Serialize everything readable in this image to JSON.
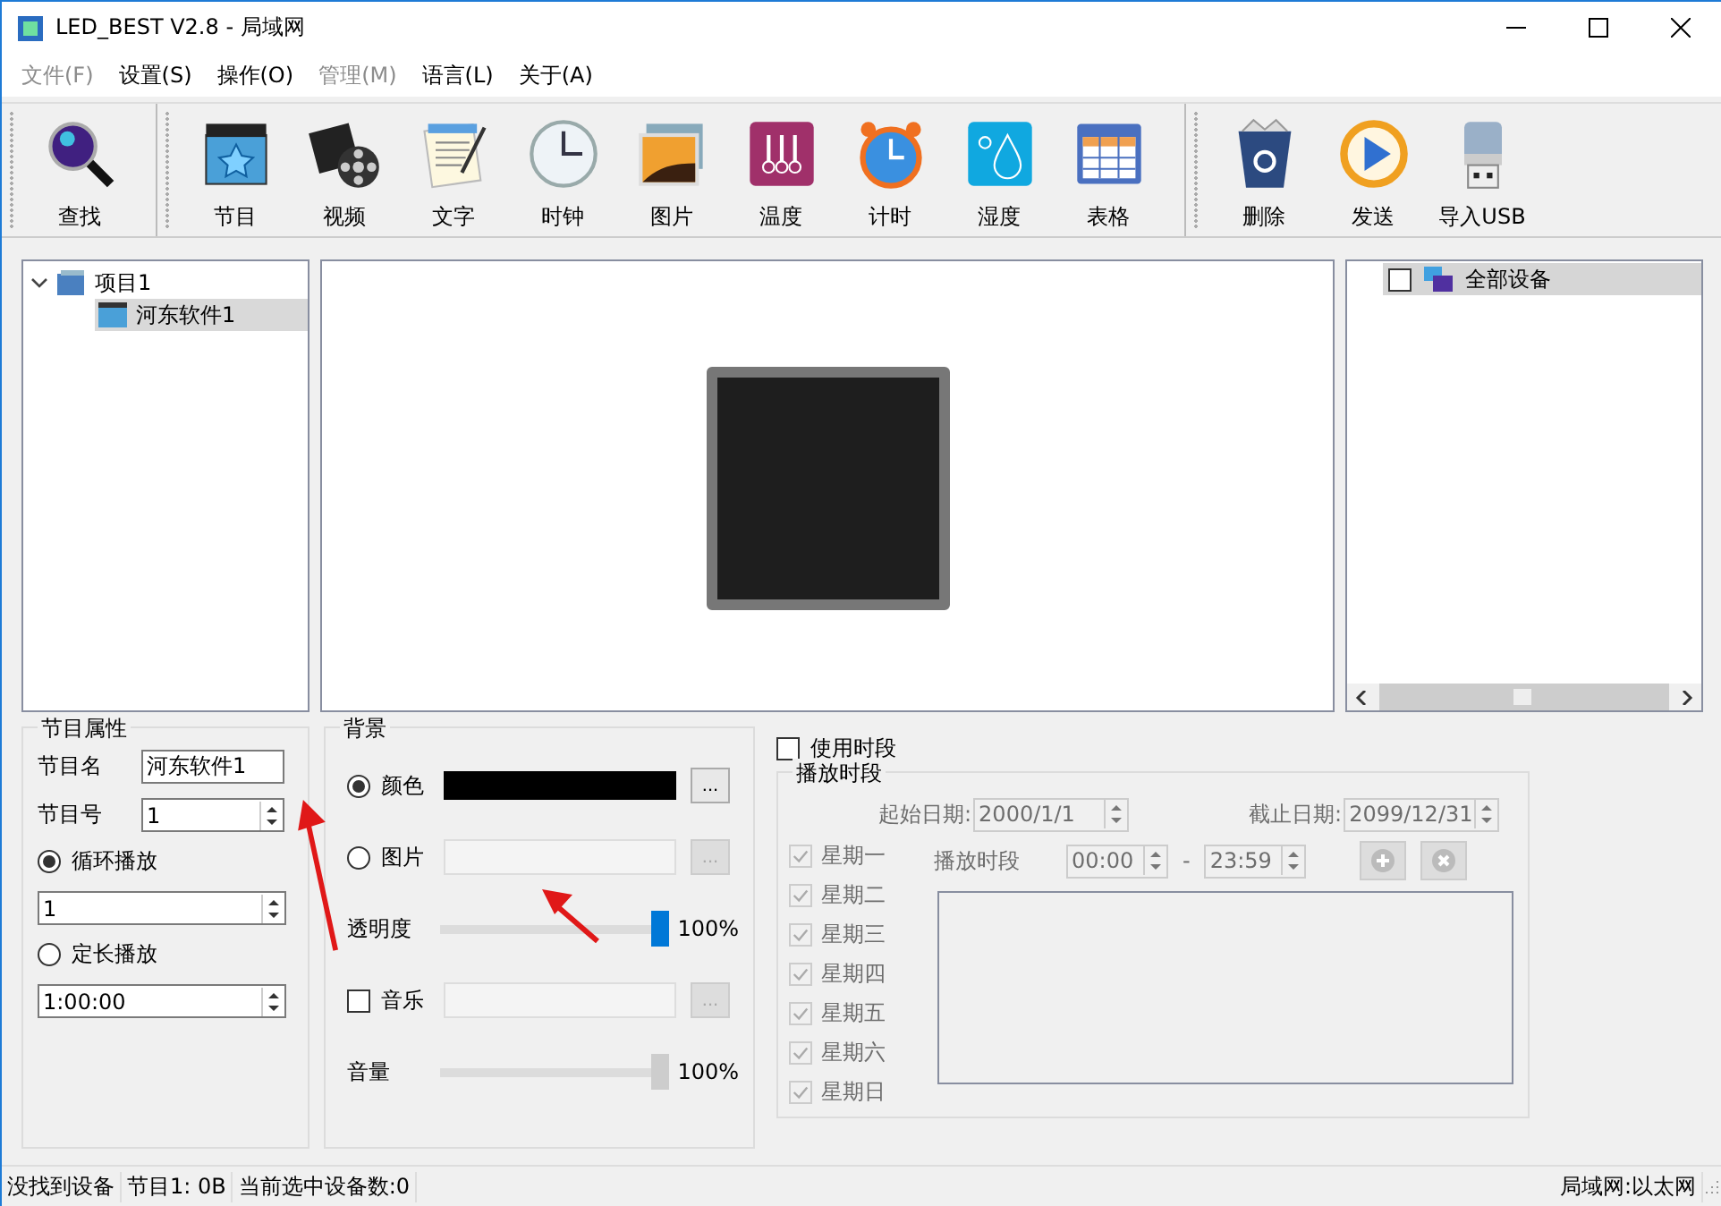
{
  "window": {
    "title": "LED_BEST V2.8 - 局域网"
  },
  "menu": [
    {
      "label": "文件(F)",
      "disabled": true
    },
    {
      "label": "设置(S)",
      "disabled": false
    },
    {
      "label": "操作(O)",
      "disabled": false
    },
    {
      "label": "管理(M)",
      "disabled": true
    },
    {
      "label": "语言(L)",
      "disabled": false
    },
    {
      "label": "关于(A)",
      "disabled": false
    }
  ],
  "toolbar": [
    {
      "items": [
        {
          "label": "查找"
        }
      ]
    },
    {
      "items": [
        {
          "label": "节目"
        },
        {
          "label": "视频"
        },
        {
          "label": "文字"
        },
        {
          "label": "时钟"
        },
        {
          "label": "图片"
        },
        {
          "label": "温度"
        },
        {
          "label": "计时"
        },
        {
          "label": "湿度"
        },
        {
          "label": "表格"
        }
      ]
    },
    {
      "items": [
        {
          "label": "删除"
        },
        {
          "label": "发送"
        },
        {
          "label": "导入USB"
        }
      ]
    }
  ],
  "program_tree": [
    {
      "label": "项目1",
      "expanded": true,
      "selected": false,
      "children": [
        {
          "label": "河东软件1",
          "selected": true
        }
      ]
    }
  ],
  "device_list": [
    {
      "label": "全部设备",
      "checked": false,
      "selected": true
    }
  ],
  "program_props": {
    "title": "节目属性",
    "name_label": "节目名",
    "name_value": "河东软件1",
    "number_label": "节目号",
    "number_value": "1",
    "modes": [
      {
        "label": "循环播放",
        "selected": true,
        "value": "1"
      },
      {
        "label": "定长播放",
        "selected": false,
        "value": "1:00:00"
      }
    ]
  },
  "background": {
    "title": "背景",
    "options": [
      {
        "kind": "color",
        "label": "颜色",
        "selected": true,
        "color": "#000000",
        "button": "..."
      },
      {
        "kind": "picture",
        "label": "图片",
        "selected": false,
        "button": "..."
      }
    ],
    "opacity": {
      "label": "透明度",
      "level": 1,
      "reading": "100%",
      "disabled": false
    },
    "music": {
      "label": "音乐",
      "checked": false,
      "button": "..."
    },
    "volume": {
      "label": "音量",
      "level": 1,
      "reading": "100%",
      "disabled": true
    }
  },
  "schedule": {
    "use_label": "使用时段",
    "use_checked": false,
    "title": "播放时段",
    "start_label": "起始日期:",
    "start_value": "2000/1/1",
    "end_label": "截止日期:",
    "end_value": "2099/12/31",
    "days": [
      {
        "label": "星期一",
        "checked": true
      },
      {
        "label": "星期二",
        "checked": true
      },
      {
        "label": "星期三",
        "checked": true
      },
      {
        "label": "星期四",
        "checked": true
      },
      {
        "label": "星期五",
        "checked": true
      },
      {
        "label": "星期六",
        "checked": true
      },
      {
        "label": "星期日",
        "checked": true
      }
    ],
    "period_label": "播放时段",
    "from": "00:00",
    "dash": "-",
    "to": "23:59"
  },
  "status_bar": {
    "left": [
      "没找到设备",
      "节目1: 0B",
      "当前选中设备数:0"
    ],
    "right": "局域网:以太网"
  }
}
